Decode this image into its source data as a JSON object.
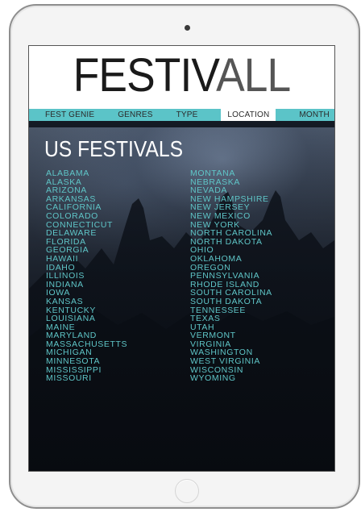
{
  "app": {
    "logo_part1": "FESTIV",
    "logo_part2": "ALL"
  },
  "nav": {
    "items": [
      {
        "label": "FEST GENIE"
      },
      {
        "label": "GENRES"
      },
      {
        "label": "TYPE"
      },
      {
        "label": "LOCATION",
        "active": true
      },
      {
        "label": "MONTH"
      }
    ]
  },
  "main": {
    "heading": "US FESTIVALS",
    "states_left": [
      "ALABAMA",
      "ALASKA",
      "ARIZONA",
      "ARKANSAS",
      "CALIFORNIA",
      "COLORADO",
      "CONNECTICUT",
      "DELAWARE",
      "FLORIDA",
      "GEORGIA",
      "HAWAII",
      "IDAHO",
      "ILLINOIS",
      "INDIANA",
      "IOWA",
      "KANSAS",
      "KENTUCKY",
      "LOUISIANA",
      "MAINE",
      "MARYLAND",
      "MASSACHUSETTS",
      "MICHIGAN",
      "MINNESOTA",
      "MISSISSIPPI",
      "MISSOURI"
    ],
    "states_right": [
      "MONTANA",
      "NEBRASKA",
      "NEVADA",
      "NEW HAMPSHIRE",
      "NEW JERSEY",
      "NEW MEXICO",
      "NEW YORK",
      "NORTH CAROLINA",
      "NORTH DAKOTA",
      "OHIO",
      "OKLAHOMA",
      "OREGON",
      "PENNSYLVANIA",
      "RHODE ISLAND",
      "SOUTH CAROLINA",
      "SOUTH DAKOTA",
      "TENNESSEE",
      "TEXAS",
      "UTAH",
      "VERMONT",
      "VIRGINIA",
      "WASHINGTON",
      "WEST VIRGINIA",
      "WISCONSIN",
      "WYOMING"
    ]
  },
  "colors": {
    "accent": "#5bc4c8",
    "state_text": "#5fc6c8",
    "heading": "#ffffff"
  },
  "icons": {
    "camera": "camera-icon",
    "home": "home-button-icon"
  }
}
